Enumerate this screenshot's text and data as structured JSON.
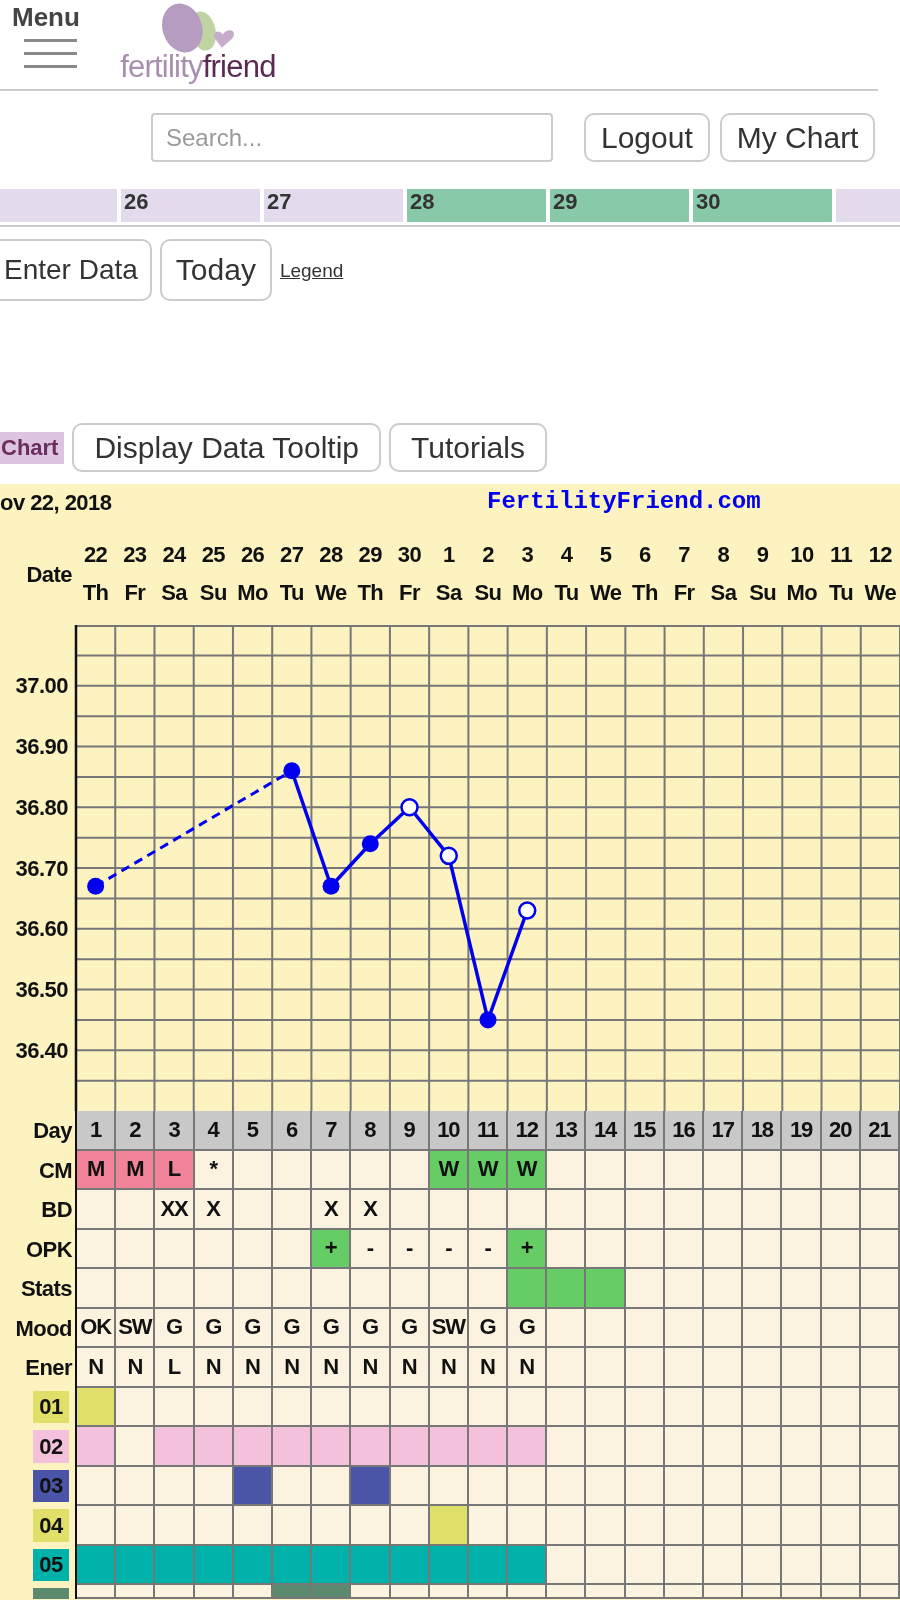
{
  "header": {
    "menu_label": "Menu",
    "logo": {
      "light": "fertility",
      "dark": "friend"
    }
  },
  "top_bar": {
    "search": {
      "placeholder": "Search..."
    },
    "buttons": [
      "Logout",
      "My Chart"
    ]
  },
  "calendar_strip": [
    {
      "color": "#e3dbeb"
    },
    {
      "date": "26",
      "color": "#e3dbeb"
    },
    {
      "date": "27",
      "color": "#e3dbeb"
    },
    {
      "date": "28",
      "color": "#87c9a8"
    },
    {
      "date": "29",
      "color": "#87c9a8"
    },
    {
      "date": "30",
      "color": "#87c9a8"
    },
    {
      "color": "#e3dbeb"
    }
  ],
  "actions": {
    "buttons": [
      "Enter Data",
      "Today"
    ],
    "link": "Legend"
  },
  "chart_toolbar": {
    "tab": "Chart",
    "buttons": [
      "Display Data Tooltip",
      "Tutorials"
    ]
  },
  "chart": {
    "title": "ov 22, 2018",
    "site": "FertilityFriend.com",
    "date_label": "Date",
    "weekdays": [
      "Th",
      "Fr",
      "Sa",
      "Su",
      "Mo",
      "Tu",
      "We",
      "Th",
      "Fr",
      "Sa",
      "Su",
      "Mo",
      "Tu",
      "We",
      "Th",
      "Fr",
      "Sa",
      "Su",
      "Mo",
      "Tu",
      "We"
    ],
    "chart_data": {
      "type": "line",
      "categories": [
        "22",
        "23",
        "24",
        "25",
        "26",
        "27",
        "28",
        "29",
        "30",
        "1",
        "2",
        "3",
        "4",
        "5",
        "6",
        "7",
        "8",
        "9",
        "10",
        "11",
        "12"
      ],
      "series": [
        {
          "color": "#0000ee",
          "marker": "circle",
          "values": [
            36.67,
            null,
            null,
            null,
            null,
            36.86,
            36.67,
            36.74,
            36.8,
            36.72,
            36.45,
            36.63,
            null,
            null,
            null,
            null,
            null,
            null,
            null,
            null,
            null
          ]
        }
      ],
      "ylim": [
        36.3,
        37.1
      ],
      "yticks": [
        {
          "value": 37.0,
          "label": "37.00"
        },
        {
          "value": 36.9,
          "label": "36.90"
        },
        {
          "value": 36.8,
          "label": "36.80"
        },
        {
          "value": 36.7,
          "label": "36.70"
        },
        {
          "value": 36.6,
          "label": "36.60"
        },
        {
          "value": 36.5,
          "label": "36.50"
        },
        {
          "value": 36.4,
          "label": "36.40"
        }
      ],
      "grid": true
    },
    "hollow_points": [
      false,
      false,
      false,
      false,
      true,
      true,
      false,
      true
    ]
  },
  "table": {
    "day_label": "Day",
    "days": [
      "1",
      "2",
      "3",
      "4",
      "5",
      "6",
      "7",
      "8",
      "9",
      "10",
      "11",
      "12",
      "13",
      "14",
      "15",
      "16",
      "17",
      "18",
      "19",
      "20",
      "21"
    ],
    "rows": [
      {
        "kind": "text",
        "label": "CM",
        "cells": [
          {
            "text": "M",
            "color": "#f28499"
          },
          {
            "text": "M",
            "color": "#f28499"
          },
          {
            "text": "L",
            "color": "#f28499"
          },
          {
            "text": "*"
          },
          null,
          null,
          null,
          null,
          null,
          {
            "text": "W",
            "color": "#66cc66"
          },
          {
            "text": "W",
            "color": "#66cc66"
          },
          {
            "text": "W",
            "color": "#66cc66"
          },
          null,
          null,
          null,
          null,
          null,
          null,
          null,
          null,
          null
        ]
      },
      {
        "kind": "text",
        "label": "BD",
        "cells": [
          null,
          null,
          {
            "text": "XX"
          },
          {
            "text": "X"
          },
          null,
          null,
          {
            "text": "X"
          },
          {
            "text": "X"
          },
          null,
          null,
          null,
          null,
          null,
          null,
          null,
          null,
          null,
          null,
          null,
          null,
          null
        ]
      },
      {
        "kind": "text",
        "label": "OPK",
        "cells": [
          null,
          null,
          null,
          null,
          null,
          null,
          {
            "text": "+",
            "color": "#66cc66"
          },
          {
            "text": "-"
          },
          {
            "text": "-"
          },
          {
            "text": "-"
          },
          {
            "text": "-"
          },
          {
            "text": "+",
            "color": "#66cc66"
          },
          null,
          null,
          null,
          null,
          null,
          null,
          null,
          null,
          null
        ]
      },
      {
        "kind": "text",
        "label": "Stats",
        "cells": [
          null,
          null,
          null,
          null,
          null,
          null,
          null,
          null,
          null,
          null,
          null,
          {
            "color": "#66cc66"
          },
          {
            "color": "#66cc66"
          },
          {
            "color": "#66cc66"
          },
          null,
          null,
          null,
          null,
          null,
          null,
          null
        ]
      },
      {
        "kind": "text",
        "label": "Mood",
        "cells": [
          {
            "text": "OK"
          },
          {
            "text": "SW"
          },
          {
            "text": "G"
          },
          {
            "text": "G"
          },
          {
            "text": "G"
          },
          {
            "text": "G"
          },
          {
            "text": "G"
          },
          {
            "text": "G"
          },
          {
            "text": "G"
          },
          {
            "text": "SW"
          },
          {
            "text": "G"
          },
          {
            "text": "G"
          },
          null,
          null,
          null,
          null,
          null,
          null,
          null,
          null,
          null
        ]
      },
      {
        "kind": "text",
        "label": "Ener",
        "cells": [
          {
            "text": "N"
          },
          {
            "text": "N"
          },
          {
            "text": "L"
          },
          {
            "text": "N"
          },
          {
            "text": "N"
          },
          {
            "text": "N"
          },
          {
            "text": "N"
          },
          {
            "text": "N"
          },
          {
            "text": "N"
          },
          {
            "text": "N"
          },
          {
            "text": "N"
          },
          {
            "text": "N"
          },
          null,
          null,
          null,
          null,
          null,
          null,
          null,
          null,
          null
        ]
      },
      {
        "kind": "band",
        "label": "01",
        "color": "#dfdf6a",
        "cells": [
          true,
          false,
          false,
          false,
          false,
          false,
          false,
          false,
          false,
          false,
          false,
          false,
          false,
          false,
          false,
          false,
          false,
          false,
          false,
          false,
          false
        ]
      },
      {
        "kind": "band",
        "label": "02",
        "color": "#f3c1dc",
        "cells": [
          true,
          false,
          true,
          true,
          true,
          true,
          true,
          true,
          true,
          true,
          true,
          true,
          false,
          false,
          false,
          false,
          false,
          false,
          false,
          false,
          false
        ]
      },
      {
        "kind": "band",
        "label": "03",
        "color": "#4b55a8",
        "cells": [
          false,
          false,
          false,
          false,
          true,
          false,
          false,
          true,
          false,
          false,
          false,
          false,
          false,
          false,
          false,
          false,
          false,
          false,
          false,
          false,
          false
        ]
      },
      {
        "kind": "band",
        "label": "04",
        "color": "#dfdf6a",
        "cells": [
          false,
          false,
          false,
          false,
          false,
          false,
          false,
          false,
          false,
          true,
          false,
          false,
          false,
          false,
          false,
          false,
          false,
          false,
          false,
          false,
          false
        ]
      },
      {
        "kind": "band",
        "label": "05",
        "color": "#00b2a9",
        "cells": [
          true,
          true,
          true,
          true,
          true,
          true,
          true,
          true,
          true,
          true,
          true,
          true,
          false,
          false,
          false,
          false,
          false,
          false,
          false,
          false,
          false
        ]
      },
      {
        "kind": "band",
        "color": "#5c8a6e",
        "cells": [
          false,
          false,
          false,
          false,
          false,
          true,
          true,
          false,
          false,
          false,
          false,
          false,
          false,
          false,
          false,
          false,
          false,
          false,
          false,
          false,
          false
        ]
      }
    ]
  }
}
